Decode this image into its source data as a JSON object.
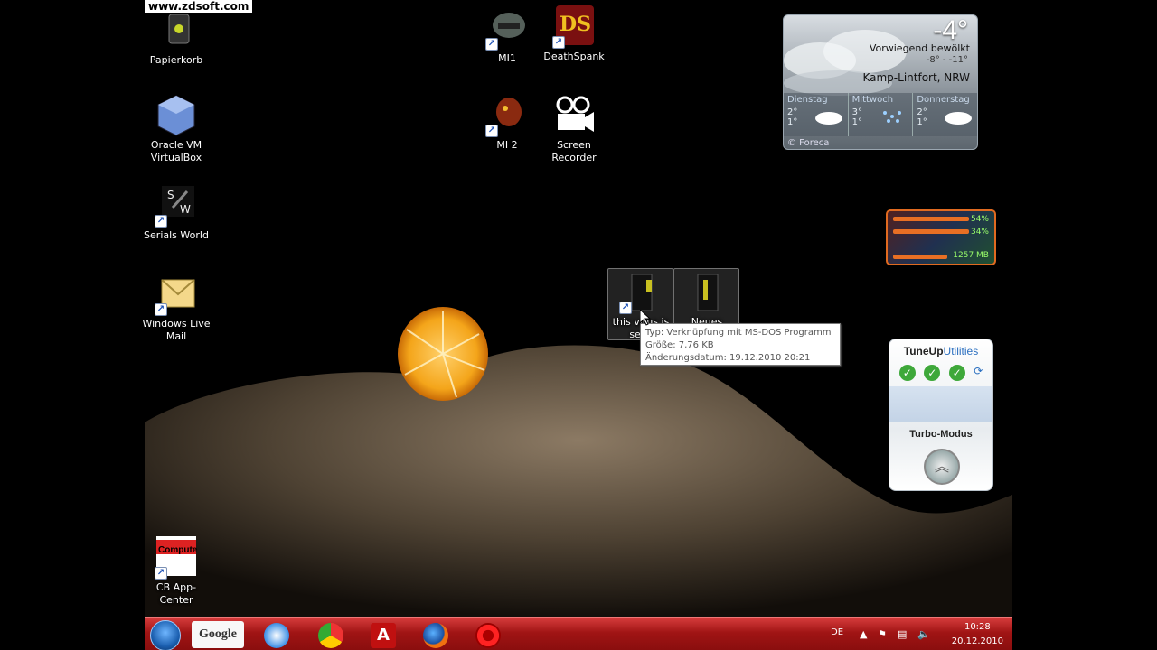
{
  "watermark": "www.zdsoft.com",
  "desktop_icons": {
    "papierkorb": "Papierkorb",
    "virtualbox": "Oracle VM VirtualBox",
    "serials": "Serials World",
    "livemail": "Windows Live Mail",
    "cb": "CB App-Center",
    "mi1": "MI1",
    "deathspank": "DeathSpank",
    "mi2": "MI 2",
    "recorder": "Screen Recorder",
    "virus": "this virus is sexy",
    "neues": "Neues"
  },
  "tooltip": {
    "type": "Typ: Verknüpfung mit MS-DOS Programm",
    "size": "Größe: 7,76 KB",
    "date": "Änderungsdatum: 19.12.2010 20:21"
  },
  "weather": {
    "temp": "-4°",
    "condition": "Vorwiegend bewölkt",
    "range": "-8°  -  -11°",
    "city": "Kamp-Lintfort, NRW",
    "days": [
      {
        "name": "Dienstag",
        "hi": "2°",
        "lo": "1°"
      },
      {
        "name": "Mittwoch",
        "hi": "3°",
        "lo": "1°"
      },
      {
        "name": "Donnerstag",
        "hi": "2°",
        "lo": "1°"
      }
    ],
    "credit": "© Foreca"
  },
  "meter": {
    "cpu1": "54%",
    "cpu2": "34%",
    "memory": "1257 MB"
  },
  "tuneup": {
    "brand": "TuneUp",
    "brand_suffix": "Utilities",
    "mode": "Turbo-Modus"
  },
  "taskbar": {
    "google": "Google",
    "lang": "DE",
    "time": "10:28",
    "date": "20.12.2010"
  },
  "colors": {
    "taskbar": "#a01414",
    "accent_orange": "#e86f24"
  }
}
